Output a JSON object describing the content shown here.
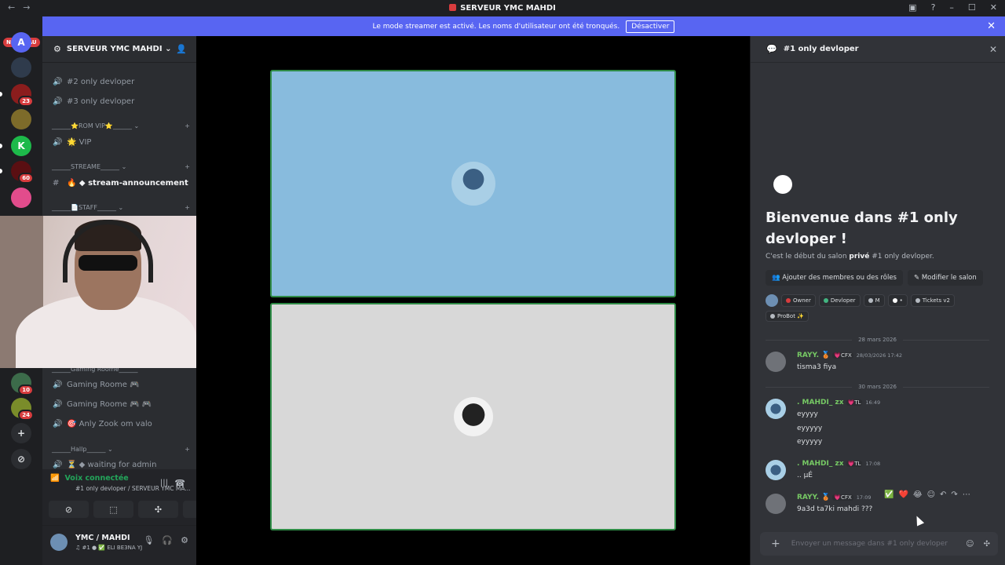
{
  "titlebar": {
    "back": "←",
    "forward": "→",
    "title": "SERVEUR YMC MAHDI",
    "controls": [
      "▣",
      "?",
      "–",
      "☐",
      "✕"
    ]
  },
  "banner": {
    "text": "Le mode streamer est activé. Les noms d'utilisateur ont été tronqués.",
    "button": "Désactiver",
    "close": "✕"
  },
  "guilds": {
    "new_label": "NOUVEAU",
    "badges": [
      "23",
      "60",
      "10",
      "24"
    ]
  },
  "sidebar": {
    "server_name": "SERVEUR YMC MAHDI",
    "server_chevron": "⌄",
    "channels": [
      {
        "icon": "🔊",
        "label": "#2 only devloper"
      },
      {
        "icon": "🔊",
        "label": "#3 only devloper"
      },
      {
        "icon": "🔊",
        "label": "🌟 VIP"
      },
      {
        "icon": "#",
        "label": "🔥 ◆ stream-announcement"
      },
      {
        "icon": "🔊",
        "label": "Gaming Roome 🎮"
      },
      {
        "icon": "🔊",
        "label": "Gaming Roome 🎮 🎮"
      },
      {
        "icon": "🔊",
        "label": "🎯 Anly Zook om valo"
      },
      {
        "icon": "🔊",
        "label": "⏳ ◆ waiting for admin"
      }
    ],
    "categories": [
      {
        "label": "______⭐ROM VIP⭐______",
        "chev": "⌄",
        "plus": "+"
      },
      {
        "label": "______STREAME______",
        "chev": "⌄",
        "plus": "+"
      },
      {
        "label": "______📄STAFF______",
        "chev": "⌄",
        "plus": "+"
      },
      {
        "label": "______Gaming Roome______",
        "chev": "",
        "plus": ""
      },
      {
        "label": "______Hallp______",
        "chev": "⌄",
        "plus": "+"
      }
    ]
  },
  "voice": {
    "status": "Voix connectée",
    "sub": "#1 only devloper / SERVEUR YMC MA..."
  },
  "user": {
    "name": "YMC / MAHDI",
    "status": "♫ #1 ● ✅ ELI BE3NA YJ"
  },
  "chat": {
    "header": "#1 only devloper",
    "welcome_title": "Bienvenue dans #1 only devloper !",
    "welcome_sub_a": "C'est le début du salon ",
    "welcome_sub_b": "privé",
    "welcome_sub_c": " #1 only devloper.",
    "action_add": "👥 Ajouter des membres ou des rôles",
    "action_edit": "✎ Modifier le salon",
    "roles": [
      {
        "label": "Owner",
        "color": "#d83c3e"
      },
      {
        "label": "Devloper",
        "color": "#43b581"
      },
      {
        "label": "M",
        "color": "#b5bac1"
      },
      {
        "label": "•",
        "color": "#ffffff"
      },
      {
        "label": "Tickets v2",
        "color": "#b5bac1"
      },
      {
        "label": "ProBot ✨",
        "color": "#b5bac1"
      }
    ],
    "dates": [
      "28 mars 2026",
      "30 mars 2026"
    ],
    "messages": [
      {
        "name": "RAYY. 🥉",
        "tag": "💗CFX",
        "time": "28/03/2026 17:42",
        "lines": [
          "tisma3 fiya"
        ]
      },
      {
        "name": ". MAHDI_ zx",
        "tag": "💗TL",
        "time": "16:49",
        "lines": [
          "eyyyy",
          "eyyyyy",
          "eyyyyy"
        ]
      },
      {
        "name": ". MAHDI_ zx",
        "tag": "💗TL",
        "time": "17:08",
        "lines": [
          ".. µÉ"
        ]
      },
      {
        "name": "RAYY. 🥉",
        "tag": "💗CFX",
        "time": "17:09",
        "lines": [
          "9a3d ta7ki mahdi ???"
        ]
      }
    ],
    "hover_actions": [
      "✅",
      "❤️",
      "😂",
      "☺",
      "↶",
      "↷",
      "⋯"
    ],
    "composer_placeholder": "Envoyer un message dans #1 only devloper"
  }
}
